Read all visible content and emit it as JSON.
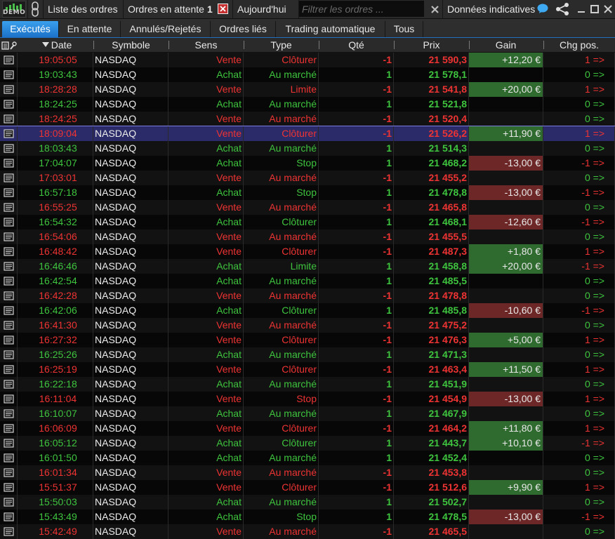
{
  "toolbar": {
    "logo_label": "DEMO",
    "order_list": "Liste des ordres",
    "pending_label": "Ordres en attente",
    "pending_count": "1",
    "period": "Aujourd'hui",
    "filter_placeholder": "Filtrer les ordres ...",
    "indicative_data": "Données indicatives"
  },
  "tabs": [
    "Exécutés",
    "En attente",
    "Annulés/Rejetés",
    "Ordres liés",
    "Trading automatique",
    "Tous"
  ],
  "active_tab": 0,
  "columns": [
    "Date",
    "Symbole",
    "Sens",
    "Type",
    "Qté",
    "Prix",
    "Gain",
    "Chg pos."
  ],
  "colors": {
    "buy": "#3ec43e",
    "sell": "#ee3333",
    "gain_positive": "#2f6a2f",
    "gain_negative": "#6e2727",
    "selected": "#2b2b6a",
    "accent": "#1e6fc0"
  },
  "rows": [
    {
      "date": "19:05:05",
      "symbol": "NASDAQ",
      "side": "Vente",
      "type": "Clôturer",
      "qty": "-1",
      "price": "21 590,3",
      "gain": "+12,20 €",
      "chg": "1 =>"
    },
    {
      "date": "19:03:43",
      "symbol": "NASDAQ",
      "side": "Achat",
      "type": "Au marché",
      "qty": "1",
      "price": "21 578,1",
      "gain": "",
      "chg": "0 =>"
    },
    {
      "date": "18:28:28",
      "symbol": "NASDAQ",
      "side": "Vente",
      "type": "Limite",
      "qty": "-1",
      "price": "21 541,8",
      "gain": "+20,00 €",
      "chg": "1 =>"
    },
    {
      "date": "18:24:25",
      "symbol": "NASDAQ",
      "side": "Achat",
      "type": "Au marché",
      "qty": "1",
      "price": "21 521,8",
      "gain": "",
      "chg": "0 =>"
    },
    {
      "date": "18:24:25",
      "symbol": "NASDAQ",
      "side": "Vente",
      "type": "Au marché",
      "qty": "-1",
      "price": "21 520,4",
      "gain": "",
      "chg": "0 =>"
    },
    {
      "date": "18:09:04",
      "symbol": "NASDAQ",
      "side": "Vente",
      "type": "Clôturer",
      "qty": "-1",
      "price": "21 526,2",
      "gain": "+11,90 €",
      "chg": "1 =>",
      "selected": true
    },
    {
      "date": "18:03:43",
      "symbol": "NASDAQ",
      "side": "Achat",
      "type": "Au marché",
      "qty": "1",
      "price": "21 514,3",
      "gain": "",
      "chg": "0 =>"
    },
    {
      "date": "17:04:07",
      "symbol": "NASDAQ",
      "side": "Achat",
      "type": "Stop",
      "qty": "1",
      "price": "21 468,2",
      "gain": "-13,00 €",
      "chg": "-1 =>"
    },
    {
      "date": "17:03:01",
      "symbol": "NASDAQ",
      "side": "Vente",
      "type": "Au marché",
      "qty": "-1",
      "price": "21 455,2",
      "gain": "",
      "chg": "0 =>"
    },
    {
      "date": "16:57:18",
      "symbol": "NASDAQ",
      "side": "Achat",
      "type": "Stop",
      "qty": "1",
      "price": "21 478,8",
      "gain": "-13,00 €",
      "chg": "-1 =>"
    },
    {
      "date": "16:55:25",
      "symbol": "NASDAQ",
      "side": "Vente",
      "type": "Au marché",
      "qty": "-1",
      "price": "21 465,8",
      "gain": "",
      "chg": "0 =>"
    },
    {
      "date": "16:54:32",
      "symbol": "NASDAQ",
      "side": "Achat",
      "type": "Clôturer",
      "qty": "1",
      "price": "21 468,1",
      "gain": "-12,60 €",
      "chg": "-1 =>"
    },
    {
      "date": "16:54:06",
      "symbol": "NASDAQ",
      "side": "Vente",
      "type": "Au marché",
      "qty": "-1",
      "price": "21 455,5",
      "gain": "",
      "chg": "0 =>"
    },
    {
      "date": "16:48:42",
      "symbol": "NASDAQ",
      "side": "Vente",
      "type": "Clôturer",
      "qty": "-1",
      "price": "21 487,3",
      "gain": "+1,80 €",
      "chg": "1 =>"
    },
    {
      "date": "16:46:46",
      "symbol": "NASDAQ",
      "side": "Achat",
      "type": "Limite",
      "qty": "1",
      "price": "21 458,8",
      "gain": "+20,00 €",
      "chg": "-1 =>"
    },
    {
      "date": "16:42:54",
      "symbol": "NASDAQ",
      "side": "Achat",
      "type": "Au marché",
      "qty": "1",
      "price": "21 485,5",
      "gain": "",
      "chg": "0 =>"
    },
    {
      "date": "16:42:28",
      "symbol": "NASDAQ",
      "side": "Vente",
      "type": "Au marché",
      "qty": "-1",
      "price": "21 478,8",
      "gain": "",
      "chg": "0 =>"
    },
    {
      "date": "16:42:06",
      "symbol": "NASDAQ",
      "side": "Achat",
      "type": "Clôturer",
      "qty": "1",
      "price": "21 485,8",
      "gain": "-10,60 €",
      "chg": "-1 =>"
    },
    {
      "date": "16:41:30",
      "symbol": "NASDAQ",
      "side": "Vente",
      "type": "Au marché",
      "qty": "-1",
      "price": "21 475,2",
      "gain": "",
      "chg": "0 =>"
    },
    {
      "date": "16:27:32",
      "symbol": "NASDAQ",
      "side": "Vente",
      "type": "Clôturer",
      "qty": "-1",
      "price": "21 476,3",
      "gain": "+5,00 €",
      "chg": "1 =>"
    },
    {
      "date": "16:25:26",
      "symbol": "NASDAQ",
      "side": "Achat",
      "type": "Au marché",
      "qty": "1",
      "price": "21 471,3",
      "gain": "",
      "chg": "0 =>"
    },
    {
      "date": "16:25:19",
      "symbol": "NASDAQ",
      "side": "Vente",
      "type": "Clôturer",
      "qty": "-1",
      "price": "21 463,4",
      "gain": "+11,50 €",
      "chg": "1 =>"
    },
    {
      "date": "16:22:18",
      "symbol": "NASDAQ",
      "side": "Achat",
      "type": "Au marché",
      "qty": "1",
      "price": "21 451,9",
      "gain": "",
      "chg": "0 =>"
    },
    {
      "date": "16:11:04",
      "symbol": "NASDAQ",
      "side": "Vente",
      "type": "Stop",
      "qty": "-1",
      "price": "21 454,9",
      "gain": "-13,00 €",
      "chg": "1 =>"
    },
    {
      "date": "16:10:07",
      "symbol": "NASDAQ",
      "side": "Achat",
      "type": "Au marché",
      "qty": "1",
      "price": "21 467,9",
      "gain": "",
      "chg": "0 =>"
    },
    {
      "date": "16:06:09",
      "symbol": "NASDAQ",
      "side": "Vente",
      "type": "Clôturer",
      "qty": "-1",
      "price": "21 464,2",
      "gain": "+11,80 €",
      "chg": "1 =>"
    },
    {
      "date": "16:05:12",
      "symbol": "NASDAQ",
      "side": "Achat",
      "type": "Clôturer",
      "qty": "1",
      "price": "21 443,7",
      "gain": "+10,10 €",
      "chg": "-1 =>"
    },
    {
      "date": "16:01:50",
      "symbol": "NASDAQ",
      "side": "Achat",
      "type": "Au marché",
      "qty": "1",
      "price": "21 452,4",
      "gain": "",
      "chg": "0 =>"
    },
    {
      "date": "16:01:34",
      "symbol": "NASDAQ",
      "side": "Vente",
      "type": "Au marché",
      "qty": "-1",
      "price": "21 453,8",
      "gain": "",
      "chg": "0 =>"
    },
    {
      "date": "15:51:37",
      "symbol": "NASDAQ",
      "side": "Vente",
      "type": "Clôturer",
      "qty": "-1",
      "price": "21 512,6",
      "gain": "+9,90 €",
      "chg": "1 =>"
    },
    {
      "date": "15:50:03",
      "symbol": "NASDAQ",
      "side": "Achat",
      "type": "Au marché",
      "qty": "1",
      "price": "21 502,7",
      "gain": "",
      "chg": "0 =>"
    },
    {
      "date": "15:43:49",
      "symbol": "NASDAQ",
      "side": "Achat",
      "type": "Stop",
      "qty": "1",
      "price": "21 478,5",
      "gain": "-13,00 €",
      "chg": "-1 =>"
    },
    {
      "date": "15:42:49",
      "symbol": "NASDAQ",
      "side": "Vente",
      "type": "Au marché",
      "qty": "-1",
      "price": "21 465,5",
      "gain": "",
      "chg": "0 =>"
    }
  ]
}
